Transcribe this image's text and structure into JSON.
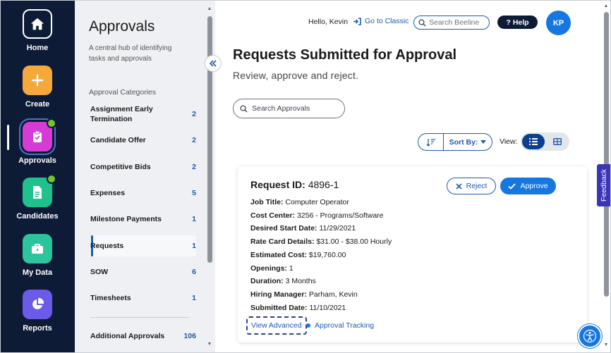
{
  "rail": {
    "items": [
      {
        "label": "Home",
        "icon": "home-icon"
      },
      {
        "label": "Create",
        "icon": "plus-icon"
      },
      {
        "label": "Approvals",
        "icon": "clipboard-check-icon"
      },
      {
        "label": "Candidates",
        "icon": "document-icon"
      },
      {
        "label": "My Data",
        "icon": "briefcase-icon"
      },
      {
        "label": "Reports",
        "icon": "pie-chart-icon"
      }
    ]
  },
  "panel": {
    "title": "Approvals",
    "description": "A central hub of identifying tasks and approvals",
    "categories_title": "Approval Categories",
    "categories": [
      {
        "label": "Assignment Early Termination",
        "count": "2"
      },
      {
        "label": "Candidate Offer",
        "count": "2"
      },
      {
        "label": "Competitive Bids",
        "count": "2"
      },
      {
        "label": "Expenses",
        "count": "5"
      },
      {
        "label": "Milestone Payments",
        "count": "1"
      },
      {
        "label": "Requests",
        "count": "1"
      },
      {
        "label": "SOW",
        "count": "6"
      },
      {
        "label": "Timesheets",
        "count": "1"
      },
      {
        "label": "Additional Approvals",
        "count": "106"
      }
    ],
    "active_category": "Requests"
  },
  "header": {
    "greeting": "Hello, Kevin",
    "classic_link": "Go to Classic",
    "search_placeholder": "Search Beeline",
    "help_label": "Help",
    "avatar_initials": "KP"
  },
  "main": {
    "title": "Requests Submitted for Approval",
    "subtitle": "Review, approve and reject.",
    "search_placeholder": "Search Approvals",
    "sort_label": "Sort By:",
    "view_label": "View:"
  },
  "request": {
    "id_label": "Request ID:",
    "id_value": "4896-1",
    "reject_label": "Reject",
    "approve_label": "Approve",
    "details": [
      {
        "key": "Job Title:",
        "value": "Computer Operator"
      },
      {
        "key": "Cost Center:",
        "value": "3256 - Programs/Software"
      },
      {
        "key": "Desired Start Date:",
        "value": "11/29/2021"
      },
      {
        "key": "Rate Card Details:",
        "value": "$31.00 - $38.00 Hourly"
      },
      {
        "key": "Estimated Cost:",
        "value": "$19,760.00"
      },
      {
        "key": "Openings:",
        "value": "1"
      },
      {
        "key": "Duration:",
        "value": "3 Months"
      },
      {
        "key": "Hiring Manager:",
        "value": "Parham, Kevin"
      },
      {
        "key": "Submitted Date:",
        "value": "11/10/2021"
      }
    ],
    "view_advanced": "View Advanced",
    "approval_tracking": "Approval Tracking"
  },
  "feedback_label": "Feedback",
  "colors": {
    "rail_bg": "#0e1b36",
    "brand_blue": "#1677e0",
    "link_blue": "#1d5ab0",
    "notification_green": "#6fc52b",
    "feedback_purple": "#3a35b7"
  }
}
